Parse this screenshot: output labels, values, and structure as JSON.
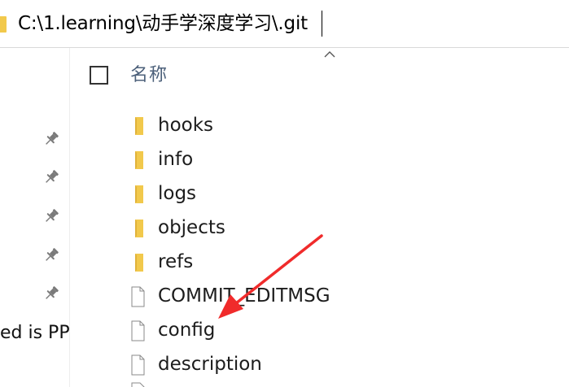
{
  "address_bar": {
    "path": "C:\\1.learning\\动手学深度学习\\.git"
  },
  "nav_pane": {
    "partial_text": "ed is PP",
    "pin_icon": "pin-icon"
  },
  "header": {
    "name_column": "名称",
    "sort_icon": "chevron-up-icon"
  },
  "items": [
    {
      "name": "hooks",
      "type": "folder"
    },
    {
      "name": "info",
      "type": "folder"
    },
    {
      "name": "logs",
      "type": "folder"
    },
    {
      "name": "objects",
      "type": "folder"
    },
    {
      "name": "refs",
      "type": "folder"
    },
    {
      "name": "COMMIT_EDITMSG",
      "type": "file"
    },
    {
      "name": "config",
      "type": "file"
    },
    {
      "name": "description",
      "type": "file"
    }
  ],
  "colors": {
    "folder": "#f2c94c",
    "arrow": "#f02b2b",
    "header_text": "#4c607a"
  }
}
